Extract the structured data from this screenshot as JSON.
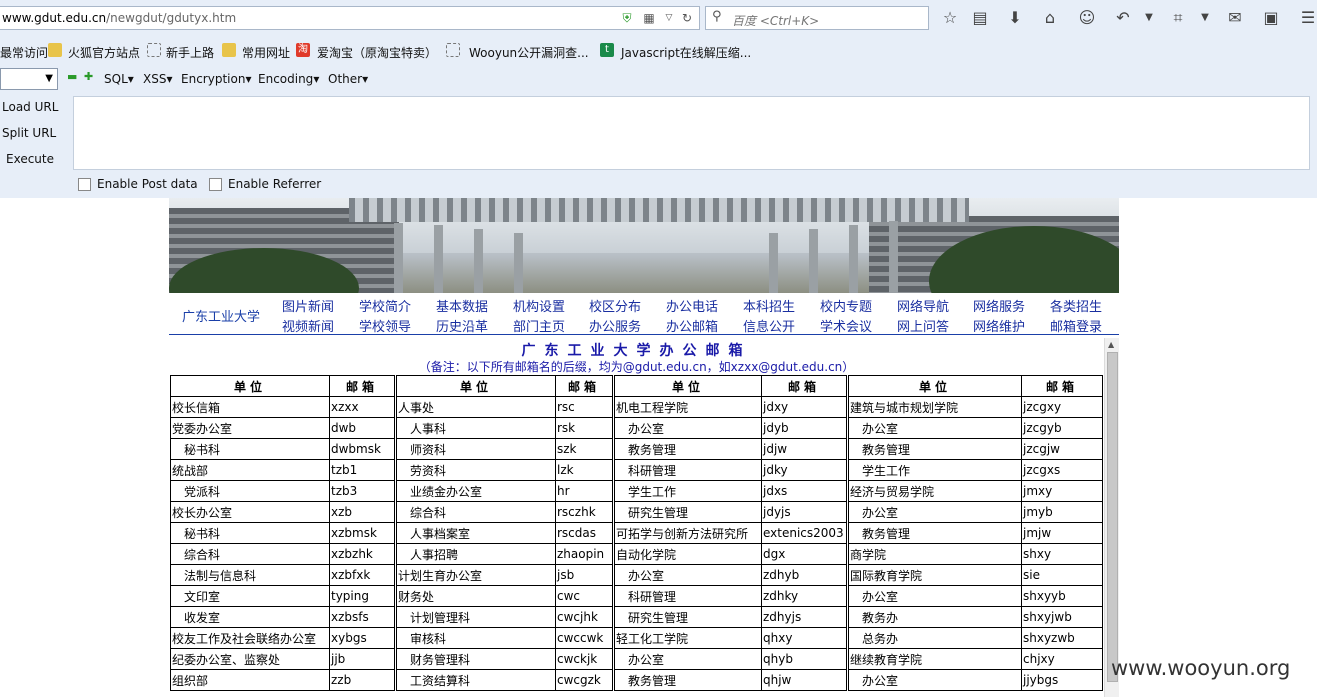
{
  "browser": {
    "url_host": "www.gdut.edu.cn",
    "url_path": "/newgdut/gdutyx.htm",
    "search_placeholder": "百度 <Ctrl+K>",
    "toolbar_icons": [
      "star-icon",
      "reading-list-icon",
      "download-icon",
      "home-icon",
      "chat-icon",
      "undo-icon",
      "crop-icon",
      "comment-icon",
      "screenshot-icon"
    ]
  },
  "bookmarks": [
    {
      "label": "最常访问",
      "icon": "none"
    },
    {
      "label": "火狐官方站点",
      "icon": "folder-icon"
    },
    {
      "label": "新手上路",
      "icon": "page-icon"
    },
    {
      "label": "常用网址",
      "icon": "folder-icon"
    },
    {
      "label": "爱淘宝（原淘宝特卖）",
      "icon": "taobao-icon"
    },
    {
      "label": "Wooyun公开漏洞查...",
      "icon": "page-icon"
    },
    {
      "label": "Javascript在线解压缩...",
      "icon": "t-icon"
    }
  ],
  "hackbar": {
    "menus": [
      "SQL",
      "XSS",
      "Encryption",
      "Encoding",
      "Other"
    ],
    "load_url": "Load URL",
    "split_url": "Split URL",
    "execute": "Execute",
    "enable_post": "Enable Post data",
    "enable_referrer": "Enable Referrer"
  },
  "site": {
    "school": "广东工业大学",
    "nav_row1": [
      "图片新闻",
      "学校简介",
      "基本数据",
      "机构设置",
      "校区分布",
      "办公电话",
      "本科招生",
      "校内专题",
      "网络导航",
      "网络服务",
      "各类招生"
    ],
    "nav_row2": [
      "视频新闻",
      "学校领导",
      "历史沿革",
      "部门主页",
      "办公服务",
      "办公邮箱",
      "信息公开",
      "学术会议",
      "网上问答",
      "网络维护",
      "邮箱登录"
    ],
    "title": "广东工业大学办公邮箱",
    "note": "（备注：以下所有邮箱名的后缀，均为@gdut.edu.cn，如xzxx@gdut.edu.cn）",
    "col_unit": "单位",
    "col_mail": "邮箱"
  },
  "tables": [
    [
      [
        "校长信箱",
        "xzxx",
        0
      ],
      [
        "党委办公室",
        "dwb",
        0
      ],
      [
        "秘书科",
        "dwbmsk",
        1
      ],
      [
        "统战部",
        "tzb1",
        0
      ],
      [
        "党派科",
        "tzb3",
        1
      ],
      [
        "校长办公室",
        "xzb",
        0
      ],
      [
        "秘书科",
        "xzbmsk",
        1
      ],
      [
        "综合科",
        "xzbzhk",
        1
      ],
      [
        "法制与信息科",
        "xzbfxk",
        1
      ],
      [
        "文印室",
        "typing",
        1
      ],
      [
        "收发室",
        "xzbsfs",
        1
      ],
      [
        "校友工作及社会联络办公室",
        "xybgs",
        0
      ],
      [
        "纪委办公室、监察处",
        "jjb",
        0
      ],
      [
        "组织部",
        "zzb",
        0
      ]
    ],
    [
      [
        "人事处",
        "rsc",
        0
      ],
      [
        "人事科",
        "rsk",
        1
      ],
      [
        "师资科",
        "szk",
        1
      ],
      [
        "劳资科",
        "lzk",
        1
      ],
      [
        "业绩金办公室",
        "hr",
        1
      ],
      [
        "综合科",
        "rsczhk",
        1
      ],
      [
        "人事档案室",
        "rscdas",
        1
      ],
      [
        "人事招聘",
        "zhaopin",
        1
      ],
      [
        "计划生育办公室",
        "jsb",
        0
      ],
      [
        "财务处",
        "cwc",
        0
      ],
      [
        "计划管理科",
        "cwcjhk",
        1
      ],
      [
        "审核科",
        "cwccwk",
        1
      ],
      [
        "财务管理科",
        "cwckjk",
        1
      ],
      [
        "工资结算科",
        "cwcgzk",
        1
      ]
    ],
    [
      [
        "机电工程学院",
        "jdxy",
        0
      ],
      [
        "办公室",
        "jdyb",
        1
      ],
      [
        "教务管理",
        "jdjw",
        1
      ],
      [
        "科研管理",
        "jdky",
        1
      ],
      [
        "学生工作",
        "jdxs",
        1
      ],
      [
        "研究生管理",
        "jdyjs",
        1
      ],
      [
        "可拓学与创新方法研究所",
        "extenics2003",
        0
      ],
      [
        "自动化学院",
        "dgx",
        0
      ],
      [
        "办公室",
        "zdhyb",
        1
      ],
      [
        "科研管理",
        "zdhky",
        1
      ],
      [
        "研究生管理",
        "zdhyjs",
        1
      ],
      [
        "轻工化工学院",
        "qhxy",
        0
      ],
      [
        "办公室",
        "qhyb",
        1
      ],
      [
        "教务管理",
        "qhjw",
        1
      ]
    ],
    [
      [
        "建筑与城市规划学院",
        "jzcgxy",
        0
      ],
      [
        "办公室",
        "jzcgyb",
        1
      ],
      [
        "教务管理",
        "jzcgjw",
        1
      ],
      [
        "学生工作",
        "jzcgxs",
        1
      ],
      [
        "经济与贸易学院",
        "jmxy",
        0
      ],
      [
        "办公室",
        "jmyb",
        1
      ],
      [
        "教务管理",
        "jmjw",
        1
      ],
      [
        "商学院",
        "shxy",
        0
      ],
      [
        "国际教育学院",
        "sie",
        0
      ],
      [
        "办公室",
        "shxyyb",
        1
      ],
      [
        "教务办",
        "shxyjwb",
        1
      ],
      [
        "总务办",
        "shxyzwb",
        1
      ],
      [
        "继续教育学院",
        "chjxy",
        0
      ],
      [
        "办公室",
        "jjybgs",
        1
      ]
    ]
  ],
  "watermark": "www.wooyun.org"
}
